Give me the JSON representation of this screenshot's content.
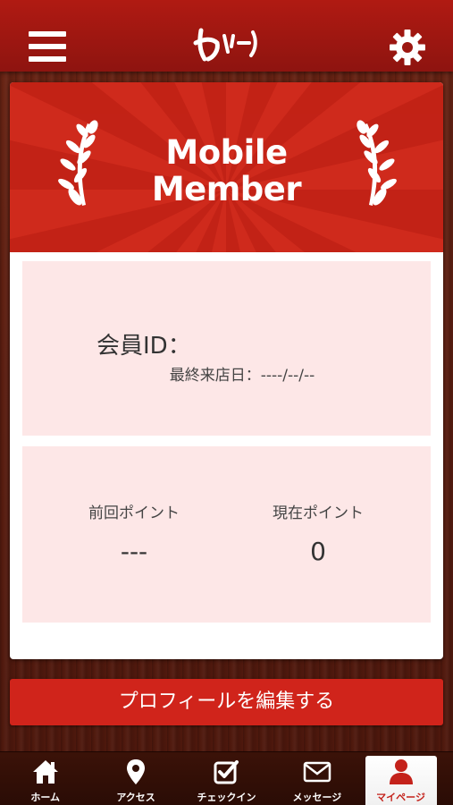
{
  "header": {
    "logo_text": "とりー",
    "menu_icon": "hamburger-menu-icon",
    "settings_icon": "gear-icon"
  },
  "banner": {
    "title_line1": "Mobile",
    "title_line2": "Member"
  },
  "member": {
    "id_label": "会員ID：",
    "id_value": "",
    "last_visit_label": "最終来店日：",
    "last_visit_value": "----/--/--"
  },
  "points": {
    "previous_label": "前回ポイント",
    "previous_value": "---",
    "current_label": "現在ポイント",
    "current_value": "0"
  },
  "edit_profile_label": "プロフィールを編集する",
  "tabs": [
    {
      "label": "ホーム",
      "icon": "home-icon",
      "active": false
    },
    {
      "label": "アクセス",
      "icon": "map-pin-icon",
      "active": false
    },
    {
      "label": "チェックイン",
      "icon": "checkin-checkbox-icon",
      "active": false
    },
    {
      "label": "メッセージ",
      "icon": "envelope-icon",
      "active": false
    },
    {
      "label": "マイページ",
      "icon": "person-icon",
      "active": true
    }
  ],
  "colors": {
    "brand_red": "#d0241b",
    "panel_pink": "#fde7e7"
  }
}
